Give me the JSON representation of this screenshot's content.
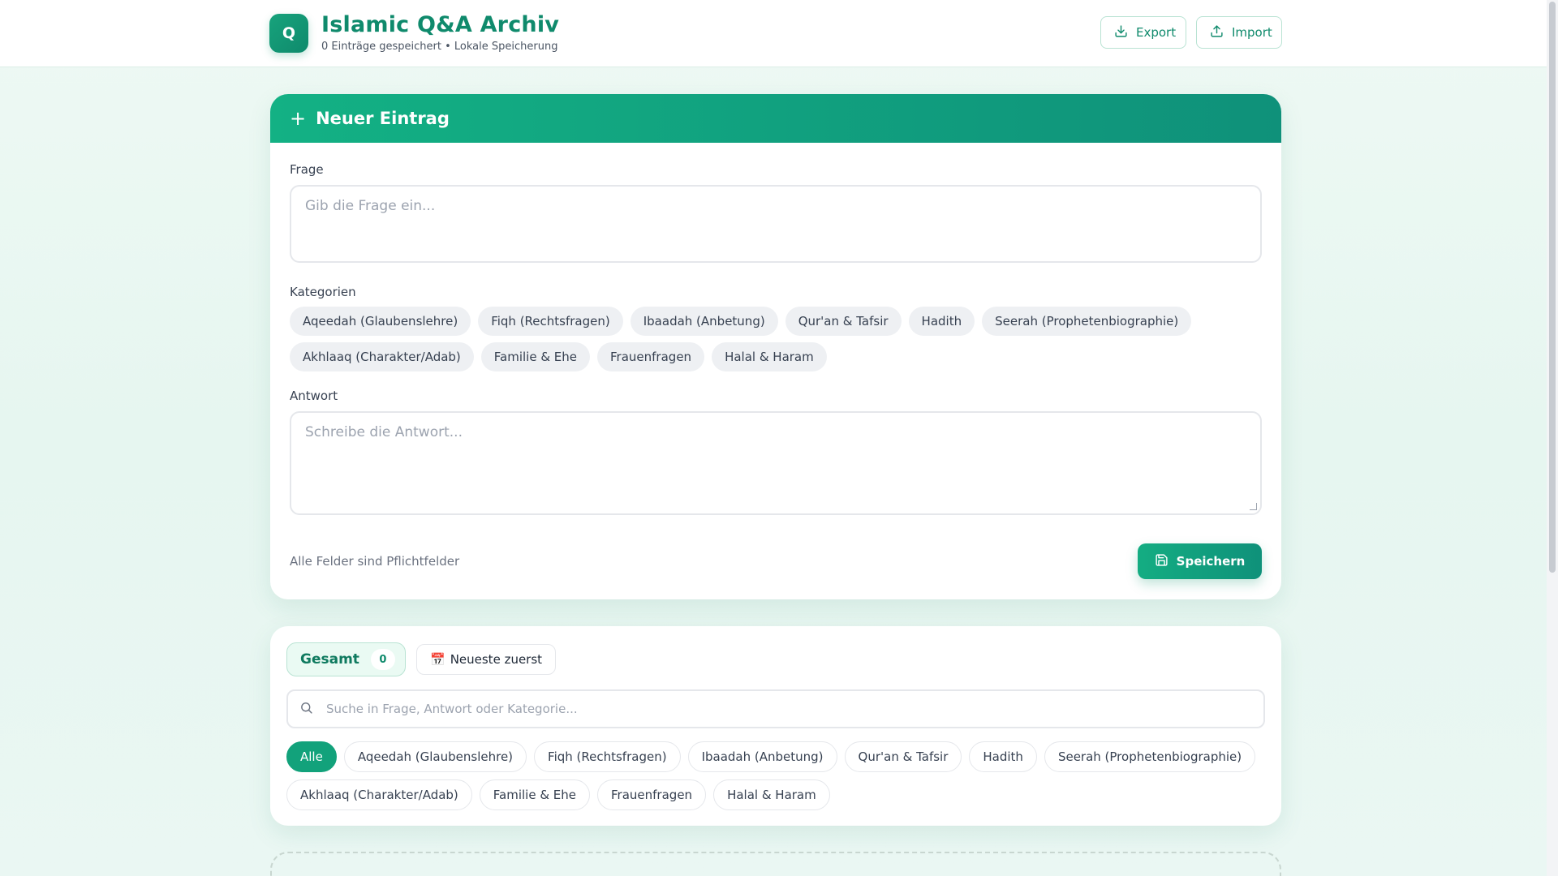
{
  "header": {
    "logo_letter": "Q",
    "title": "Islamic Q&A Archiv",
    "subtitle": "0 Einträge gespeichert • Lokale Speicherung",
    "export_label": "Export",
    "import_label": "Import"
  },
  "entry": {
    "title": "Neuer Eintrag",
    "question_label": "Frage",
    "question_placeholder": "Gib die Frage ein...",
    "categories_label": "Kategorien",
    "categories": [
      "Aqeedah (Glaubenslehre)",
      "Fiqh (Rechtsfragen)",
      "Ibaadah (Anbetung)",
      "Qur'an & Tafsir",
      "Hadith",
      "Seerah (Prophetenbiographie)",
      "Akhlaaq (Charakter/Adab)",
      "Familie & Ehe",
      "Frauenfragen",
      "Halal & Haram"
    ],
    "answer_label": "Antwort",
    "answer_placeholder": "Schreibe die Antwort...",
    "required_note": "Alle Felder sind Pflichtfelder",
    "save_label": "Speichern"
  },
  "filters": {
    "total_label": "Gesamt",
    "total_count": "0",
    "sort_icon": "📅",
    "sort_label": "Neueste zuerst",
    "search_placeholder": "Suche in Frage, Antwort oder Kategorie...",
    "chips": [
      "Alle",
      "Aqeedah (Glaubenslehre)",
      "Fiqh (Rechtsfragen)",
      "Ibaadah (Anbetung)",
      "Qur'an & Tafsir",
      "Hadith",
      "Seerah (Prophetenbiographie)",
      "Akhlaaq (Charakter/Adab)",
      "Familie & Ehe",
      "Frauenfragen",
      "Halal & Haram"
    ],
    "active_chip": "Alle"
  },
  "colors": {
    "accent": "#12a27b",
    "accent_dark": "#0f8a6c",
    "background": "#e9f7f1"
  }
}
